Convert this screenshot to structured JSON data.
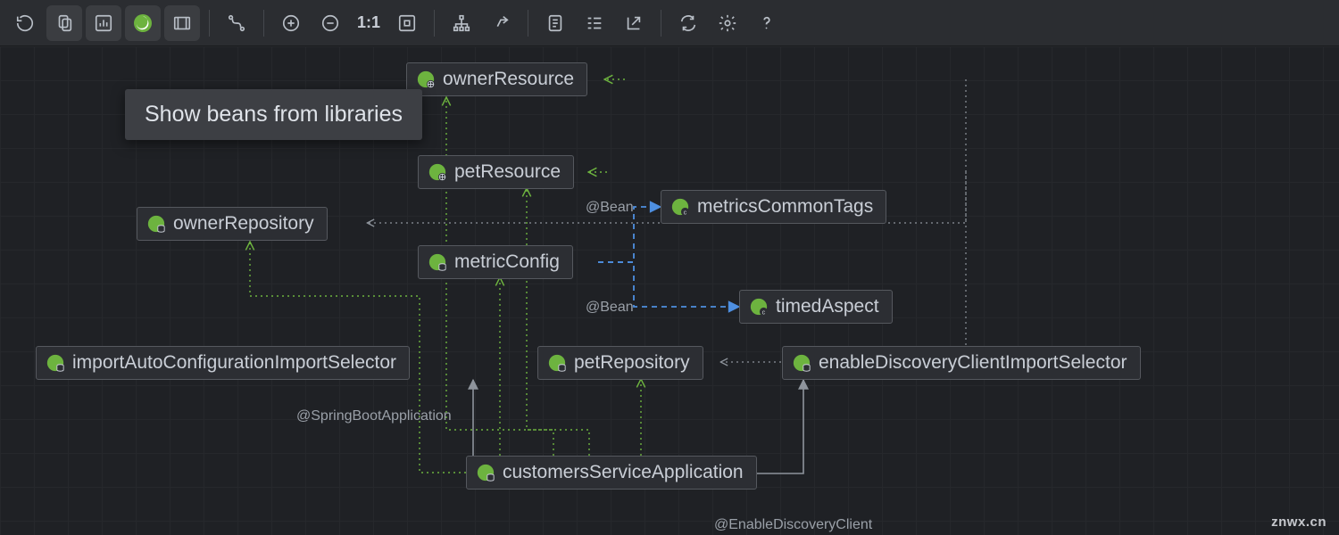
{
  "toolbar": {
    "zoom_ratio": "1:1"
  },
  "tooltip": {
    "text": "Show beans from libraries"
  },
  "nodes": {
    "ownerResource": "ownerResource",
    "petResource": "petResource",
    "ownerRepository": "ownerRepository",
    "metricConfig": "metricConfig",
    "metricsCommonTags": "metricsCommonTags",
    "timedAspect": "timedAspect",
    "importAutoConfigurationImportSelector": "importAutoConfigurationImportSelector",
    "petRepository": "petRepository",
    "enableDiscoveryClientImportSelector": "enableDiscoveryClientImportSelector",
    "customersServiceApplication": "customersServiceApplication"
  },
  "edgeLabels": {
    "bean1": "@Bean",
    "bean2": "@Bean",
    "springBootApp": "@SpringBootApplication",
    "enableDiscovery": "@EnableDiscoveryClient"
  },
  "watermark": "znwx.cn"
}
